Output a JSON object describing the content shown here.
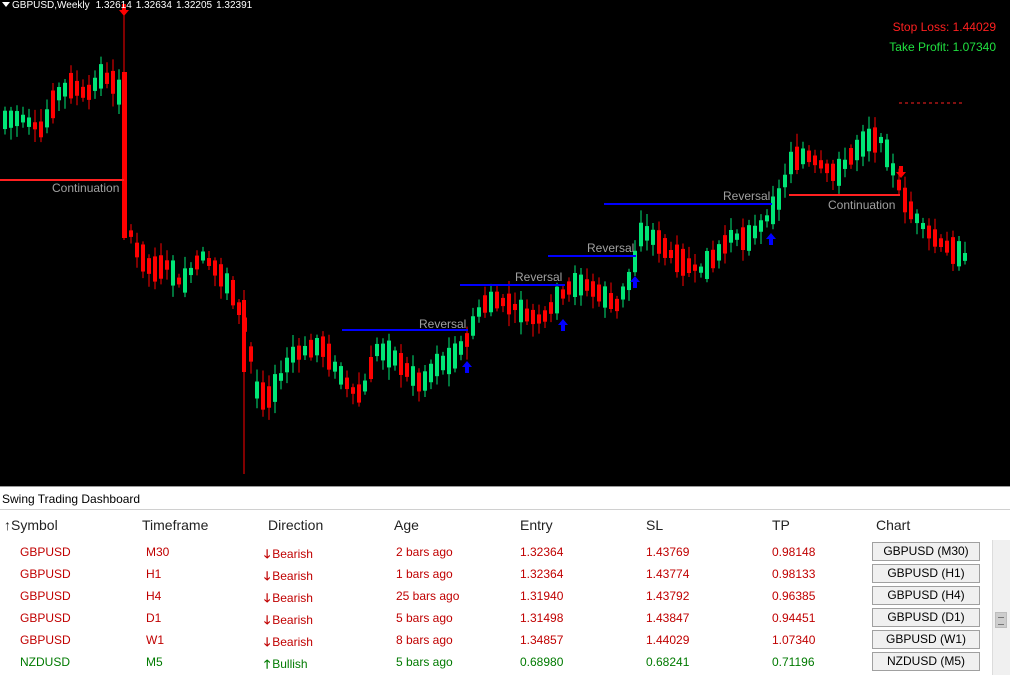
{
  "chart": {
    "symbol": "GBPUSD,Weekly",
    "quotes": [
      "1.32614",
      "1.32634",
      "1.32205",
      "1.32391"
    ],
    "stop_loss": "Stop Loss: 1.44029",
    "take_profit": "Take Profit: 1.07340",
    "annotations": [
      "Continuation",
      "Reversal",
      "Reversal",
      "Reversal",
      "Reversal",
      "Continuation"
    ],
    "colors": {
      "bull": "#00e676",
      "bear": "#ff0000",
      "level": "#0000ff",
      "level_red": "#ff2020",
      "label": "#a0a0a0"
    }
  },
  "dashboard": {
    "title": "Swing Trading Dashboard",
    "columns": [
      "Symbol",
      "Timeframe",
      "Direction",
      "Age",
      "Entry",
      "SL",
      "TP",
      "Chart"
    ],
    "sort_icon": "↑",
    "rows": [
      {
        "symbol": "GBPUSD",
        "timeframe": "M30",
        "direction": "Bearish",
        "age": "2 bars ago",
        "entry": "1.32364",
        "sl": "1.43769",
        "tp": "0.98148",
        "chart": "GBPUSD (M30)",
        "trend": "bear"
      },
      {
        "symbol": "GBPUSD",
        "timeframe": "H1",
        "direction": "Bearish",
        "age": "1 bars ago",
        "entry": "1.32364",
        "sl": "1.43774",
        "tp": "0.98133",
        "chart": "GBPUSD (H1)",
        "trend": "bear"
      },
      {
        "symbol": "GBPUSD",
        "timeframe": "H4",
        "direction": "Bearish",
        "age": "25 bars ago",
        "entry": "1.31940",
        "sl": "1.43792",
        "tp": "0.96385",
        "chart": "GBPUSD (H4)",
        "trend": "bear"
      },
      {
        "symbol": "GBPUSD",
        "timeframe": "D1",
        "direction": "Bearish",
        "age": "5 bars ago",
        "entry": "1.31498",
        "sl": "1.43847",
        "tp": "0.94451",
        "chart": "GBPUSD (D1)",
        "trend": "bear"
      },
      {
        "symbol": "GBPUSD",
        "timeframe": "W1",
        "direction": "Bearish",
        "age": "8 bars ago",
        "entry": "1.34857",
        "sl": "1.44029",
        "tp": "1.07340",
        "chart": "GBPUSD (W1)",
        "trend": "bear"
      },
      {
        "symbol": "NZDUSD",
        "timeframe": "M5",
        "direction": "Bullish",
        "age": "5 bars ago",
        "entry": "0.68980",
        "sl": "0.68241",
        "tp": "0.71196",
        "chart": "NZDUSD (M5)",
        "trend": "bull"
      }
    ],
    "icons": {
      "bearish": "arrow-down-icon",
      "bullish": "arrow-up-icon"
    }
  }
}
